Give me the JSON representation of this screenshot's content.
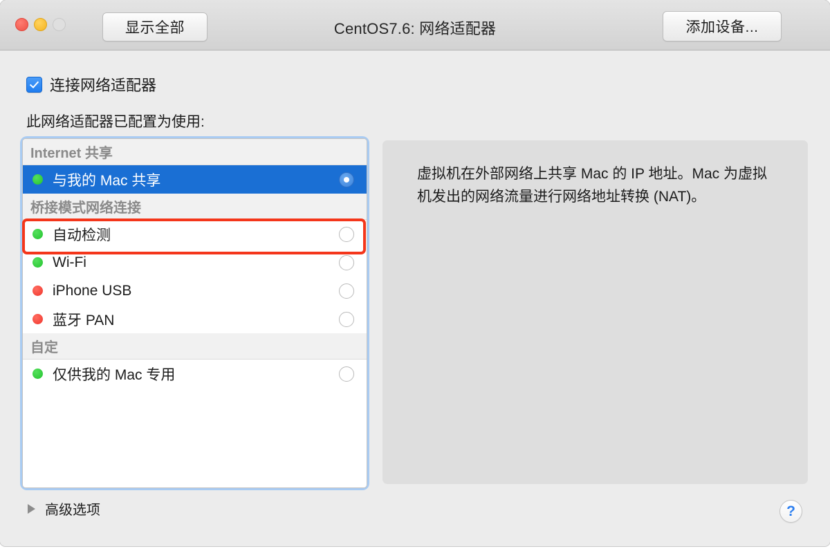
{
  "window": {
    "title": "CentOS7.6: 网络适配器",
    "traffic_lights": [
      "close",
      "minimize",
      "zoom"
    ],
    "colors": {
      "close": "#ed5247",
      "minimize": "#f5b422",
      "zoom": "#dfdfdf",
      "selection_blue": "#1a6fd4",
      "focus_ring": "#a9cbf2",
      "annotation_red": "#f4361b",
      "status_green": "#23c32f",
      "status_red": "#f0362c",
      "toolbar": "#d8d8d8",
      "body": "#ececec",
      "panel": "#dedede"
    }
  },
  "toolbar": {
    "show_all_label": "显示全部",
    "add_device_label": "添加设备..."
  },
  "settings": {
    "connect_checkbox_label": "连接网络适配器",
    "connect_checkbox_checked": true,
    "configured_label": "此网络适配器已配置为使用:"
  },
  "network_list": {
    "groups": [
      {
        "header": "Internet 共享",
        "items": [
          {
            "label": "与我的 Mac 共享",
            "status": "green",
            "selected": true
          }
        ]
      },
      {
        "header": "桥接模式网络连接",
        "items": [
          {
            "label": "自动检测",
            "status": "green",
            "selected": false
          },
          {
            "label": "Wi-Fi",
            "status": "green",
            "selected": false
          },
          {
            "label": "iPhone USB",
            "status": "red",
            "selected": false
          },
          {
            "label": "蓝牙 PAN",
            "status": "red",
            "selected": false
          }
        ]
      },
      {
        "header": "自定",
        "items": [
          {
            "label": "仅供我的 Mac 专用",
            "status": "green",
            "selected": false
          }
        ]
      }
    ]
  },
  "description": {
    "text": "虚拟机在外部网络上共享 Mac 的 IP 地址。Mac 为虚拟机发出的网络流量进行网络地址转换 (NAT)。"
  },
  "footer": {
    "advanced_label": "高级选项",
    "advanced_expanded": false,
    "help_label": "?"
  }
}
